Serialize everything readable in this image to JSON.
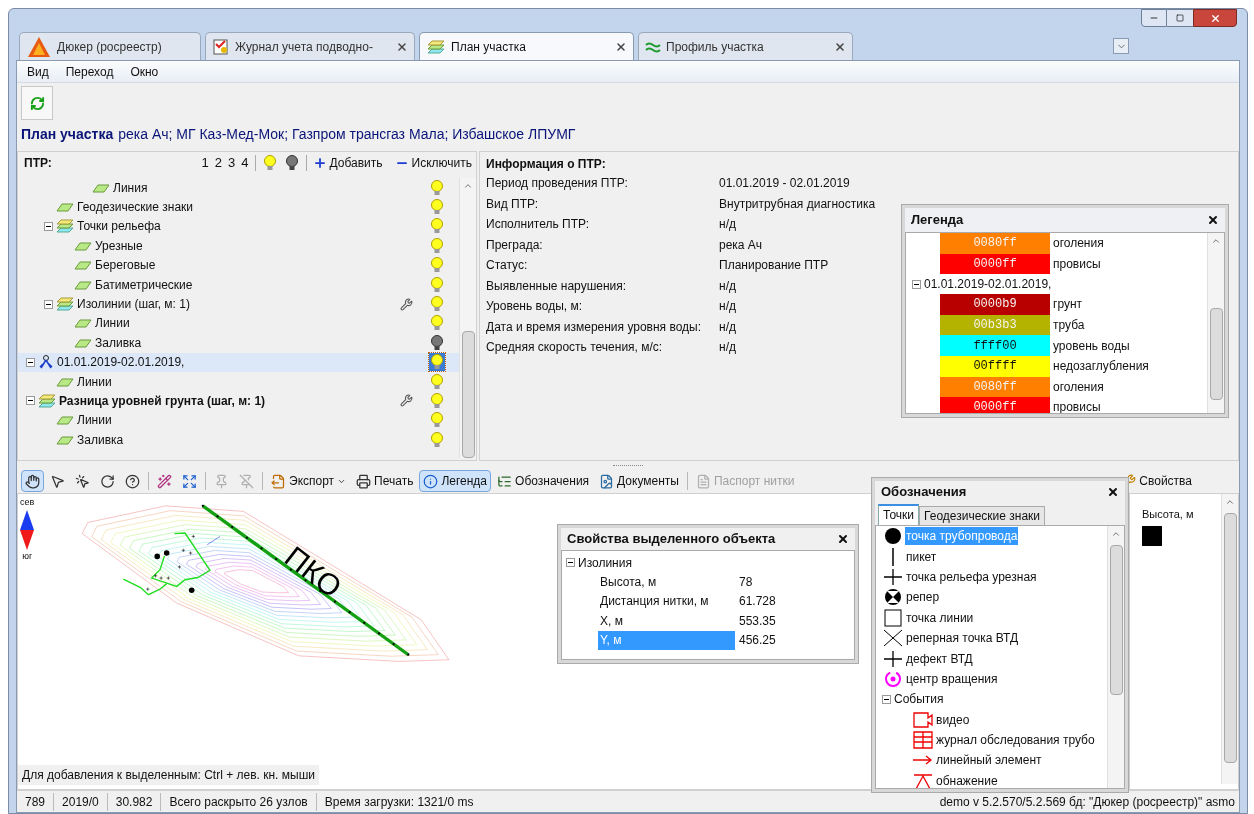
{
  "window": {
    "tabs": [
      {
        "label": "Дюкер (росреестр)",
        "kind": "app",
        "selected": false,
        "closable": false
      },
      {
        "label": "Журнал учета подводно-",
        "kind": "journal",
        "selected": false,
        "closable": true
      },
      {
        "label": "План участка",
        "kind": "plan",
        "selected": true,
        "closable": true
      },
      {
        "label": "Профиль участка",
        "kind": "profile",
        "selected": false,
        "closable": true
      }
    ]
  },
  "menu": [
    "Вид",
    "Переход",
    "Окно"
  ],
  "page_title": {
    "title": "План участка",
    "subtitle": "река Ач; МГ Каз-Мед-Мок; Газпром трансгаз Мала; Избашское ЛПУМГ"
  },
  "ptr_panel": {
    "title": "ПТР:",
    "levels": [
      "1",
      "2",
      "3",
      "4"
    ],
    "add": "Добавить",
    "exclude": "Исключить"
  },
  "tree": {
    "items": [
      {
        "children": [
          {
            "children": [
              {
                "children": [
                  {
                    "label": "Линия",
                    "kind": "layer",
                    "bulb_on": true,
                    "selected": false,
                    "bold": false,
                    "settings": false
                  }
                ]
              }
            ]
          },
          {
            "label": "Геодезические знаки",
            "kind": "layer",
            "bulb_on": true,
            "selected": false,
            "bold": false,
            "settings": false
          },
          {
            "label": "Точки рельефа",
            "kind": "group",
            "bulb_on": true,
            "selected": false,
            "bold": false,
            "settings": false,
            "expanded": true,
            "children": [
              {
                "label": "Урезные",
                "kind": "layer",
                "bulb_on": true,
                "selected": false,
                "bold": false,
                "settings": false
              },
              {
                "label": "Береговые",
                "kind": "layer",
                "bulb_on": true,
                "selected": false,
                "bold": false,
                "settings": false
              },
              {
                "label": "Батиметрические",
                "kind": "layer",
                "bulb_on": true,
                "selected": false,
                "bold": false,
                "settings": false
              }
            ]
          },
          {
            "label": "Изолинии (шаг, м: 1)",
            "kind": "group",
            "bulb_on": true,
            "selected": false,
            "bold": false,
            "settings": true,
            "expanded": true,
            "children": [
              {
                "label": "Линии",
                "kind": "layer",
                "bulb_on": true,
                "selected": false,
                "bold": false,
                "settings": false
              },
              {
                "label": "Заливка",
                "kind": "layer",
                "bulb_on": false,
                "selected": false,
                "bold": false,
                "settings": false
              }
            ]
          }
        ]
      },
      {
        "label": "01.01.2019-02.01.2019,",
        "kind": "survey",
        "bulb_on": true,
        "selected": true,
        "bold": false,
        "settings": false,
        "expanded": true,
        "children": [
          {
            "label": "Линии",
            "kind": "layer",
            "bulb_on": true,
            "selected": false,
            "bold": false,
            "settings": false
          }
        ]
      },
      {
        "label": "Разница уровней грунта (шаг, м: 1)",
        "kind": "group",
        "bulb_on": true,
        "selected": false,
        "bold": true,
        "settings": true,
        "expanded": true,
        "children": [
          {
            "label": "Линии",
            "kind": "layer",
            "bulb_on": true,
            "selected": false,
            "bold": false,
            "settings": false
          },
          {
            "label": "Заливка",
            "kind": "layer",
            "bulb_on": true,
            "selected": false,
            "bold": false,
            "settings": false
          }
        ]
      }
    ]
  },
  "info": {
    "title": "Информация о ПТР:",
    "rows": [
      {
        "label": "Период проведения ПТР:",
        "value": "01.01.2019 - 02.01.2019"
      },
      {
        "label": "Вид ПТР:",
        "value": "Внутритрубная диагностика"
      },
      {
        "label": "Исполнитель ПТР:",
        "value": "н/д"
      },
      {
        "label": "Преграда:",
        "value": "река Ач"
      },
      {
        "label": "Статус:",
        "value": "Планирование ПТР"
      },
      {
        "label": "Выявленные нарушения:",
        "value": "н/д"
      },
      {
        "label": "Уровень воды, м:",
        "value": "н/д"
      },
      {
        "label": "Дата и время измерения уровня воды:",
        "value": "н/д"
      },
      {
        "label": "Средняя скорость течения, м/с:",
        "value": "н/д"
      }
    ]
  },
  "legend": {
    "title": "Легенда",
    "groups": [
      {
        "entries": [
          {
            "code": "0080ff",
            "color": "#ff8000",
            "label": "оголения"
          },
          {
            "code": "0000ff",
            "color": "#ff0000",
            "label": "провисы"
          }
        ]
      },
      {
        "label": "01.01.2019-02.01.2019,",
        "expanded": true,
        "entries": [
          {
            "code": "0000b9",
            "color": "#b90000",
            "label": "грунт"
          },
          {
            "code": "00b3b3",
            "color": "#b3b300",
            "label": "труба"
          },
          {
            "code": "ffff00",
            "color": "#00ffff",
            "label": "уровень воды"
          },
          {
            "code": "00ffff",
            "color": "#ffff00",
            "label": "недозаглубления"
          },
          {
            "code": "0080ff",
            "color": "#ff8000",
            "label": "оголения"
          },
          {
            "code": "0000ff",
            "color": "#ff0000",
            "label": "провисы"
          }
        ]
      }
    ]
  },
  "map_toolbar": {
    "groups": [
      [
        {
          "kind": "pan",
          "selected": true,
          "disabled": false
        },
        {
          "kind": "pointer",
          "selected": false,
          "disabled": false
        },
        {
          "kind": "select-add",
          "selected": false,
          "disabled": false
        },
        {
          "kind": "rotate",
          "selected": false,
          "disabled": false
        },
        {
          "kind": "query",
          "selected": false,
          "disabled": false
        }
      ],
      [
        {
          "kind": "wand",
          "selected": false,
          "disabled": false
        },
        {
          "kind": "fit",
          "selected": false,
          "disabled": false
        }
      ],
      [
        {
          "kind": "pin",
          "selected": false,
          "disabled": true
        },
        {
          "kind": "unpin",
          "selected": false,
          "disabled": true
        }
      ],
      [
        {
          "kind": "export",
          "label": "Экспорт",
          "dropdown": true,
          "selected": false,
          "disabled": false
        },
        {
          "kind": "print",
          "label": "Печать",
          "selected": false,
          "disabled": false
        },
        {
          "kind": "legend",
          "label": "Легенда",
          "selected": true,
          "disabled": false
        },
        {
          "kind": "symbols",
          "label": "Обозначения",
          "selected": false,
          "disabled": false
        },
        {
          "kind": "documents",
          "label": "Документы",
          "selected": false,
          "disabled": false
        }
      ],
      [
        {
          "kind": "passport",
          "label": "Паспорт нитки",
          "selected": false,
          "disabled": true
        }
      ]
    ],
    "properties": "Свойства"
  },
  "map": {
    "north": "сев",
    "south": "юг",
    "label": "ПКО",
    "hint": "Для добавления к выделенным: Ctrl + лев. кн. мыши"
  },
  "properties_panel": {
    "title": "Свойства выделенного объекта",
    "group": {
      "label": "Изолиния",
      "expanded": true,
      "rows": [
        {
          "label": "Высота, м",
          "value": "78",
          "selected": false
        },
        {
          "label": "Дистанция нитки, м",
          "value": "61.728",
          "selected": false
        },
        {
          "label": "X, м",
          "value": "553.35",
          "selected": false
        },
        {
          "label": "Y, м",
          "value": "456.25",
          "selected": true
        }
      ]
    }
  },
  "symbols_panel": {
    "title": "Обозначения",
    "tabs": [
      {
        "label": "Точки",
        "selected": true
      },
      {
        "label": "Геодезические знаки",
        "selected": false
      }
    ],
    "items": [
      {
        "label": "точка трубопровода",
        "kind": "dot",
        "selected": true
      },
      {
        "label": "пикет",
        "kind": "tick",
        "selected": false
      },
      {
        "label": "точка рельефа урезная",
        "kind": "cross",
        "selected": false
      },
      {
        "label": "репер",
        "kind": "benchmark",
        "selected": false
      },
      {
        "label": "точка линии",
        "kind": "square",
        "selected": false
      },
      {
        "label": "реперная точка ВТД",
        "kind": "x",
        "selected": false
      },
      {
        "label": "дефект ВТД",
        "kind": "cross",
        "selected": false
      },
      {
        "label": "центр вращения",
        "kind": "rotation",
        "selected": false
      }
    ],
    "group": {
      "label": "События",
      "expanded": true,
      "items": [
        {
          "label": "видео",
          "kind": "video",
          "selected": false
        },
        {
          "label": "журнал обследования трубо",
          "kind": "journal",
          "selected": false
        },
        {
          "label": "линейный элемент",
          "kind": "linear",
          "selected": false
        },
        {
          "label": "обнажение",
          "kind": "exposure",
          "selected": false
        }
      ]
    }
  },
  "height_panel": {
    "label": "Высота, м"
  },
  "status_bar": {
    "cells": [
      "789",
      "2019/0",
      "30.982",
      "Всего раскрыто 26 узлов"
    ],
    "load_time": "Время загрузки: 1321/0 ms",
    "version": "demo  v 5.2.570/5.2.569 бд: \"Дюкер (росреестр)\" asmo"
  }
}
